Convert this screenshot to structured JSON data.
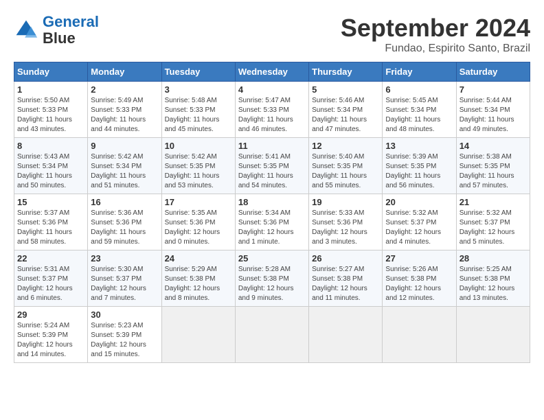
{
  "header": {
    "logo_line1": "General",
    "logo_line2": "Blue",
    "title": "September 2024",
    "subtitle": "Fundao, Espirito Santo, Brazil"
  },
  "calendar": {
    "days_of_week": [
      "Sunday",
      "Monday",
      "Tuesday",
      "Wednesday",
      "Thursday",
      "Friday",
      "Saturday"
    ],
    "weeks": [
      [
        {
          "day": "1",
          "info": "Sunrise: 5:50 AM\nSunset: 5:33 PM\nDaylight: 11 hours\nand 43 minutes."
        },
        {
          "day": "2",
          "info": "Sunrise: 5:49 AM\nSunset: 5:33 PM\nDaylight: 11 hours\nand 44 minutes."
        },
        {
          "day": "3",
          "info": "Sunrise: 5:48 AM\nSunset: 5:33 PM\nDaylight: 11 hours\nand 45 minutes."
        },
        {
          "day": "4",
          "info": "Sunrise: 5:47 AM\nSunset: 5:33 PM\nDaylight: 11 hours\nand 46 minutes."
        },
        {
          "day": "5",
          "info": "Sunrise: 5:46 AM\nSunset: 5:34 PM\nDaylight: 11 hours\nand 47 minutes."
        },
        {
          "day": "6",
          "info": "Sunrise: 5:45 AM\nSunset: 5:34 PM\nDaylight: 11 hours\nand 48 minutes."
        },
        {
          "day": "7",
          "info": "Sunrise: 5:44 AM\nSunset: 5:34 PM\nDaylight: 11 hours\nand 49 minutes."
        }
      ],
      [
        {
          "day": "8",
          "info": "Sunrise: 5:43 AM\nSunset: 5:34 PM\nDaylight: 11 hours\nand 50 minutes."
        },
        {
          "day": "9",
          "info": "Sunrise: 5:42 AM\nSunset: 5:34 PM\nDaylight: 11 hours\nand 51 minutes."
        },
        {
          "day": "10",
          "info": "Sunrise: 5:42 AM\nSunset: 5:35 PM\nDaylight: 11 hours\nand 53 minutes."
        },
        {
          "day": "11",
          "info": "Sunrise: 5:41 AM\nSunset: 5:35 PM\nDaylight: 11 hours\nand 54 minutes."
        },
        {
          "day": "12",
          "info": "Sunrise: 5:40 AM\nSunset: 5:35 PM\nDaylight: 11 hours\nand 55 minutes."
        },
        {
          "day": "13",
          "info": "Sunrise: 5:39 AM\nSunset: 5:35 PM\nDaylight: 11 hours\nand 56 minutes."
        },
        {
          "day": "14",
          "info": "Sunrise: 5:38 AM\nSunset: 5:35 PM\nDaylight: 11 hours\nand 57 minutes."
        }
      ],
      [
        {
          "day": "15",
          "info": "Sunrise: 5:37 AM\nSunset: 5:36 PM\nDaylight: 11 hours\nand 58 minutes."
        },
        {
          "day": "16",
          "info": "Sunrise: 5:36 AM\nSunset: 5:36 PM\nDaylight: 11 hours\nand 59 minutes."
        },
        {
          "day": "17",
          "info": "Sunrise: 5:35 AM\nSunset: 5:36 PM\nDaylight: 12 hours\nand 0 minutes."
        },
        {
          "day": "18",
          "info": "Sunrise: 5:34 AM\nSunset: 5:36 PM\nDaylight: 12 hours\nand 1 minute."
        },
        {
          "day": "19",
          "info": "Sunrise: 5:33 AM\nSunset: 5:36 PM\nDaylight: 12 hours\nand 3 minutes."
        },
        {
          "day": "20",
          "info": "Sunrise: 5:32 AM\nSunset: 5:37 PM\nDaylight: 12 hours\nand 4 minutes."
        },
        {
          "day": "21",
          "info": "Sunrise: 5:32 AM\nSunset: 5:37 PM\nDaylight: 12 hours\nand 5 minutes."
        }
      ],
      [
        {
          "day": "22",
          "info": "Sunrise: 5:31 AM\nSunset: 5:37 PM\nDaylight: 12 hours\nand 6 minutes."
        },
        {
          "day": "23",
          "info": "Sunrise: 5:30 AM\nSunset: 5:37 PM\nDaylight: 12 hours\nand 7 minutes."
        },
        {
          "day": "24",
          "info": "Sunrise: 5:29 AM\nSunset: 5:38 PM\nDaylight: 12 hours\nand 8 minutes."
        },
        {
          "day": "25",
          "info": "Sunrise: 5:28 AM\nSunset: 5:38 PM\nDaylight: 12 hours\nand 9 minutes."
        },
        {
          "day": "26",
          "info": "Sunrise: 5:27 AM\nSunset: 5:38 PM\nDaylight: 12 hours\nand 11 minutes."
        },
        {
          "day": "27",
          "info": "Sunrise: 5:26 AM\nSunset: 5:38 PM\nDaylight: 12 hours\nand 12 minutes."
        },
        {
          "day": "28",
          "info": "Sunrise: 5:25 AM\nSunset: 5:38 PM\nDaylight: 12 hours\nand 13 minutes."
        }
      ],
      [
        {
          "day": "29",
          "info": "Sunrise: 5:24 AM\nSunset: 5:39 PM\nDaylight: 12 hours\nand 14 minutes."
        },
        {
          "day": "30",
          "info": "Sunrise: 5:23 AM\nSunset: 5:39 PM\nDaylight: 12 hours\nand 15 minutes."
        },
        {
          "day": "",
          "info": ""
        },
        {
          "day": "",
          "info": ""
        },
        {
          "day": "",
          "info": ""
        },
        {
          "day": "",
          "info": ""
        },
        {
          "day": "",
          "info": ""
        }
      ]
    ]
  }
}
